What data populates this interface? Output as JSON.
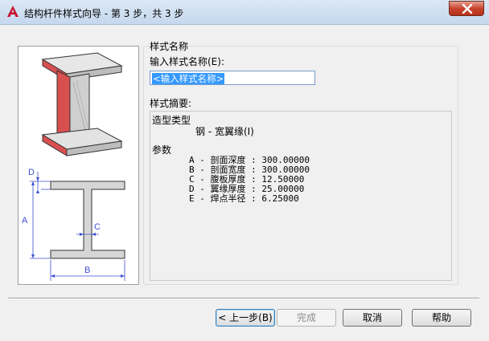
{
  "window": {
    "title": "结构杆件样式向导 - 第 3 步，共 3 步"
  },
  "section": {
    "style_name_heading": "样式名称",
    "input_label": "输入样式名称(E):",
    "input_value": "<输入样式名称>",
    "summary_label": "样式摘要:"
  },
  "summary": {
    "shape_type_heading": "造型类型",
    "shape_type_value": "钢 - 宽翼缘(I)",
    "params_heading": "参数",
    "params": [
      "A - 剖面深度 : 300.00000",
      "B - 剖面宽度 : 300.00000",
      "C - 腹板厚度 : 12.50000",
      "D - 翼缘厚度 : 25.00000",
      "E - 焊点半径 : 6.25000"
    ]
  },
  "diagram": {
    "labels": {
      "a": "A",
      "b": "B",
      "c": "C",
      "d": "D"
    }
  },
  "buttons": {
    "back": "< 上一步(B)",
    "finish": "完成",
    "cancel": "取消",
    "help": "帮助"
  },
  "colors": {
    "accent_red": "#d94f4f",
    "dimension_blue": "#3d4fd1",
    "selection_blue": "#3399ff"
  }
}
